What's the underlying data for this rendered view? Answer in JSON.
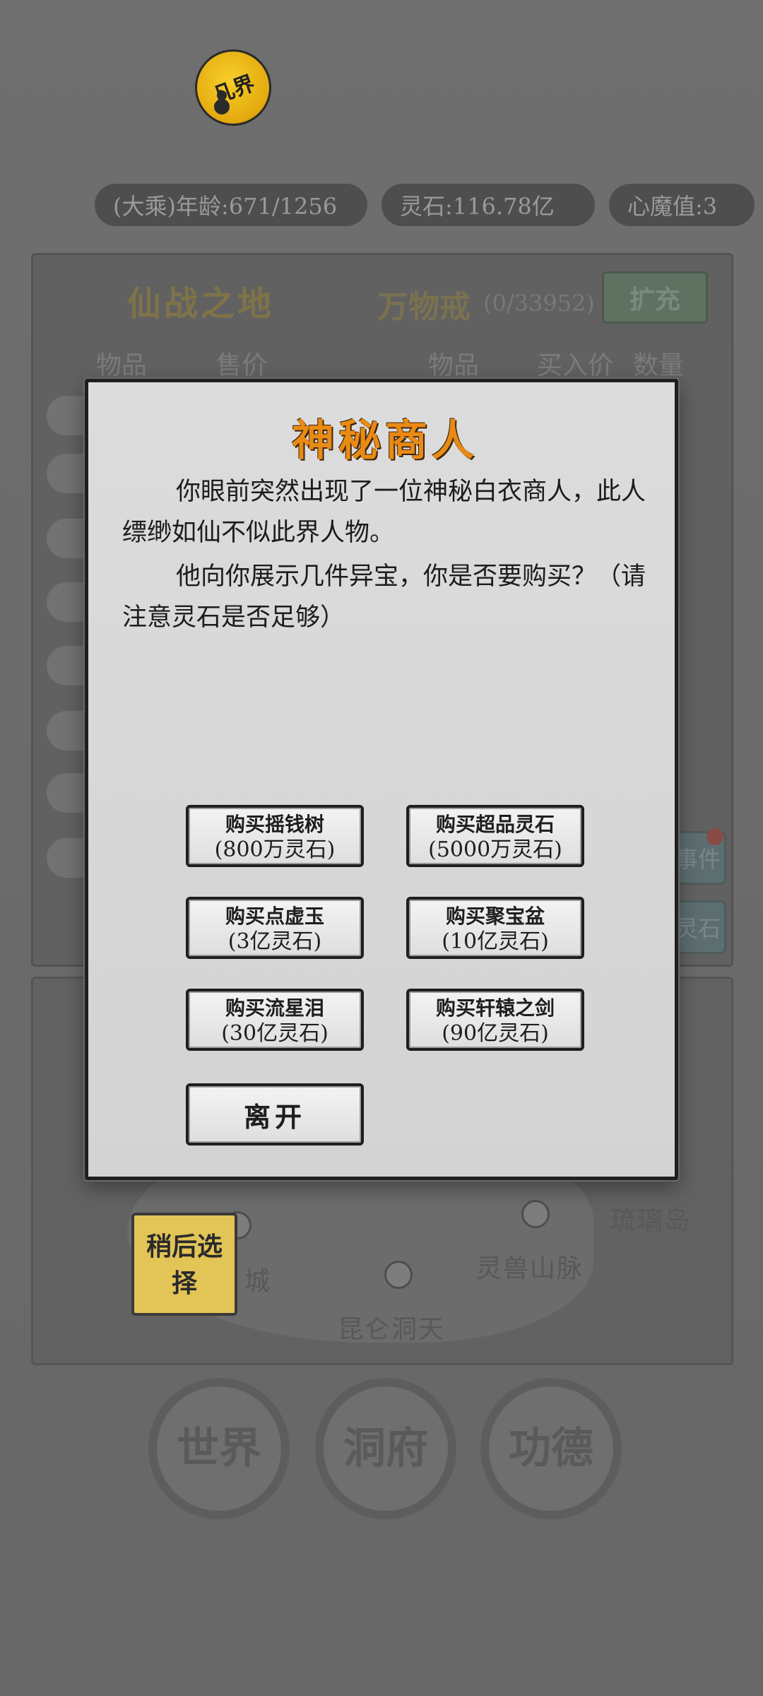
{
  "header": {
    "logo_text": "凡界",
    "stats": {
      "age": "(大乘)年龄:671/1256",
      "spirit_stones": "灵石:116.78亿",
      "heart_demon": "心魔值:3"
    }
  },
  "market": {
    "title": "仙战之地",
    "ring_title": "万物戒",
    "ring_count": "(0/33952)",
    "expand_label": "扩充",
    "left_headers": [
      "物品",
      "售价"
    ],
    "right_headers": [
      "物品",
      "买入价",
      "数量"
    ],
    "side_buttons": [
      "事件",
      "灵石"
    ]
  },
  "map": {
    "labels": [
      "琉璃岛",
      "灵兽山脉",
      "昆仑洞天",
      "城"
    ],
    "later_button": "稍后选择"
  },
  "bottom_nav": [
    "世界",
    "洞府",
    "功德"
  ],
  "dialog": {
    "title": "神秘商人",
    "paragraph1": "你眼前突然出现了一位神秘白衣商人，此人缥缈如仙不似此界人物。",
    "paragraph2": "他向你展示几件异宝，你是否要购买？（请注意灵石是否足够）",
    "buttons": [
      {
        "label": "购买摇钱树",
        "price": "(800万灵石)"
      },
      {
        "label": "购买超品灵石",
        "price": "(5000万灵石)"
      },
      {
        "label": "购买点虚玉",
        "price": "(3亿灵石)"
      },
      {
        "label": "购买聚宝盆",
        "price": "(10亿灵石)"
      },
      {
        "label": "购买流星泪",
        "price": "(30亿灵石)"
      },
      {
        "label": "购买轩辕之剑",
        "price": "(90亿灵石)"
      }
    ],
    "leave_label": "离开"
  },
  "colors": {
    "title_orange": "#e98a14",
    "later_yellow": "#e2c457",
    "logo_gold": "#f2c21c"
  }
}
